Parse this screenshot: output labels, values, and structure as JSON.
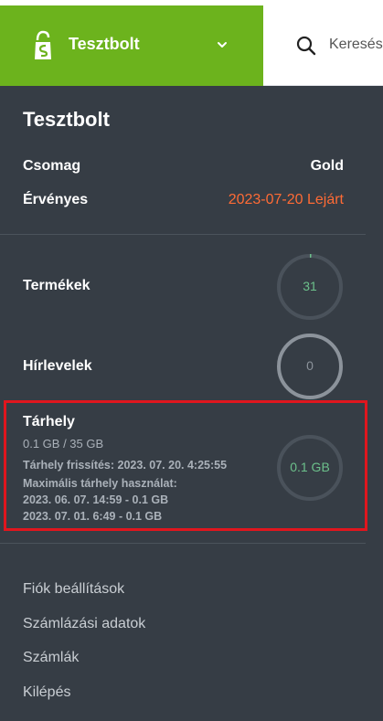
{
  "header": {
    "store_name": "Tesztbolt",
    "search_placeholder": "Keresés"
  },
  "account": {
    "title": "Tesztbolt",
    "package_label": "Csomag",
    "package_value": "Gold",
    "valid_label": "Érvényes",
    "valid_value": "2023-07-20 Lejárt"
  },
  "stats": {
    "products": {
      "label": "Termékek",
      "value": "31"
    },
    "newsletters": {
      "label": "Hírlevelek",
      "value": "0"
    }
  },
  "storage": {
    "label": "Tárhely",
    "usage": "0.1 GB / 35 GB",
    "refresh": "Tárhely frissítés: 2023. 07. 20. 4:25:55",
    "max_label": "Maximális tárhely használat:",
    "max_entries": [
      "2023. 06. 07. 14:59 - 0.1 GB",
      "2023. 07. 01. 6:49 - 0.1 GB"
    ],
    "ring_text": "0.1 GB",
    "used_gb": 0.1,
    "total_gb": 35
  },
  "menu": [
    "Fiók beállítások",
    "Számlázási adatok",
    "Számlák",
    "Kilépés"
  ],
  "colors": {
    "brand_green": "#6cb31d",
    "panel_bg": "#363d45",
    "expired_orange": "#ff6b35",
    "ring_green": "#6cc08b",
    "highlight_red": "#e0161e"
  }
}
